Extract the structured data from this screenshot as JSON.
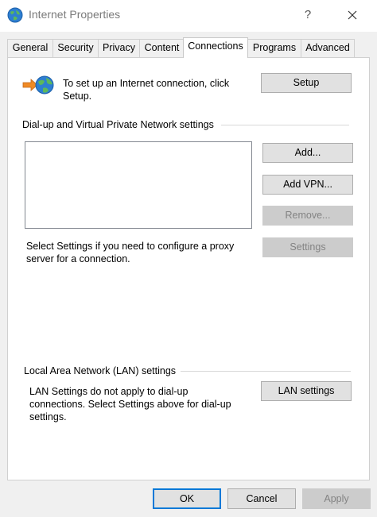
{
  "window": {
    "title": "Internet Properties",
    "help_label": "?",
    "icon": "globe-icon"
  },
  "tabs": [
    {
      "label": "General"
    },
    {
      "label": "Security"
    },
    {
      "label": "Privacy"
    },
    {
      "label": "Content"
    },
    {
      "label": "Connections",
      "active": true
    },
    {
      "label": "Programs"
    },
    {
      "label": "Advanced"
    }
  ],
  "setup": {
    "text_line1": "To set up an Internet connection, click",
    "text_line2": "Setup.",
    "button_label": "Setup",
    "icon": "network-connection-icon"
  },
  "dialup": {
    "header": "Dial-up and Virtual Private Network settings",
    "connections": [],
    "add_label": "Add...",
    "add_vpn_label": "Add VPN...",
    "remove_label": "Remove...",
    "settings_label": "Settings",
    "proxy_text_line1": "Select Settings if you need to configure a proxy",
    "proxy_text_line2": "server for a connection."
  },
  "lan": {
    "header": "Local Area Network (LAN) settings",
    "text_line1": "LAN Settings do not apply to dial-up",
    "text_line2": "connections. Select Settings above for dial-up",
    "text_line3": "settings.",
    "button_label": "LAN settings"
  },
  "footer": {
    "ok_label": "OK",
    "cancel_label": "Cancel",
    "apply_label": "Apply"
  },
  "colors": {
    "accent": "#0078d7",
    "disabled_text": "#838383"
  }
}
